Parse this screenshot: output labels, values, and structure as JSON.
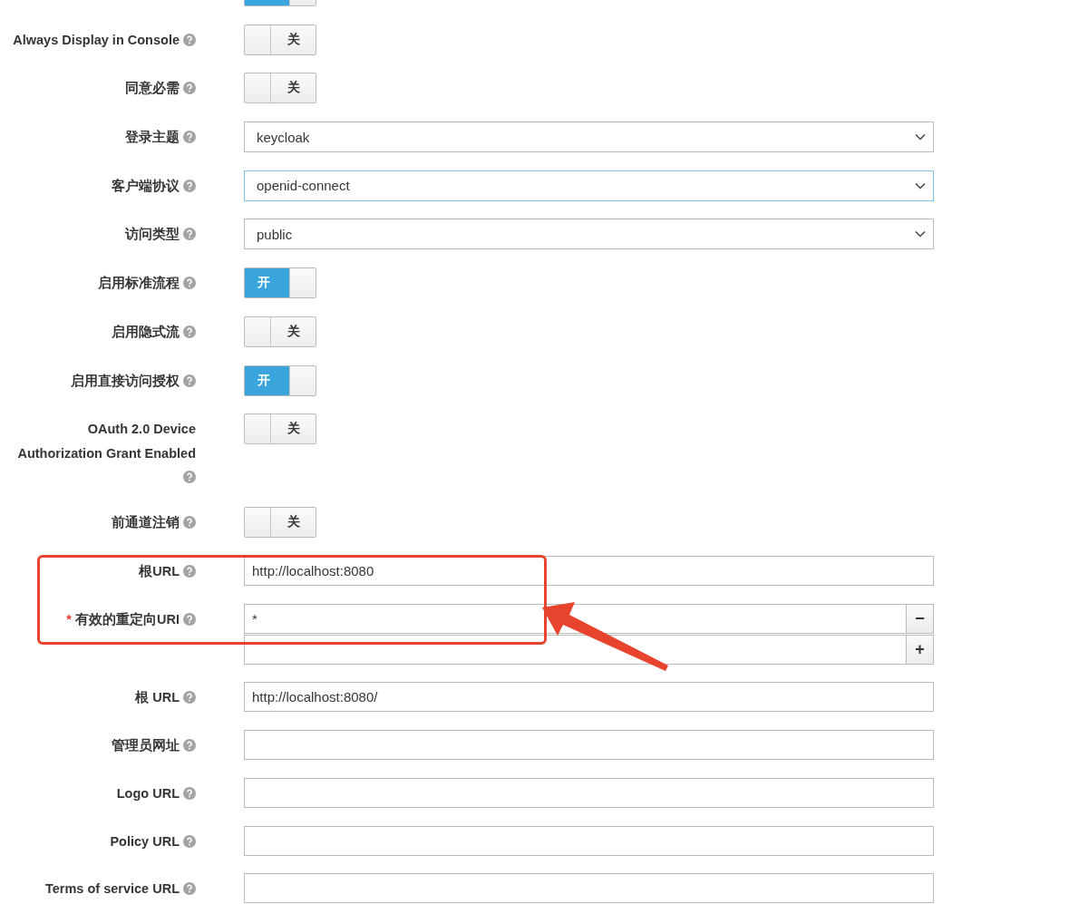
{
  "form": {
    "rows": [
      {
        "kind": "toggle",
        "on": true
      },
      {
        "kind": "toggle",
        "label": "Always Display in Console",
        "on": false,
        "text": "关"
      },
      {
        "kind": "toggle",
        "label": "同意必需",
        "on": false,
        "text": "关"
      },
      {
        "kind": "select",
        "label": "登录主题",
        "value": "keycloak",
        "focused": false
      },
      {
        "kind": "select",
        "label": "客户端协议",
        "value": "openid-connect",
        "focused": true
      },
      {
        "kind": "select",
        "label": "访问类型",
        "value": "public",
        "focused": false
      },
      {
        "kind": "toggle",
        "label": "启用标准流程",
        "on": true,
        "text": "开"
      },
      {
        "kind": "toggle",
        "label": "启用隐式流",
        "on": false,
        "text": "关"
      },
      {
        "kind": "toggle",
        "label": "启用直接访问授权",
        "on": true,
        "text": "开"
      },
      {
        "kind": "toggle",
        "label": "OAuth 2.0 Device Authorization Grant Enabled",
        "on": false,
        "text": "关"
      },
      {
        "kind": "toggle",
        "label": "前通道注销",
        "on": false,
        "text": "关"
      },
      {
        "kind": "input",
        "label": "根URL",
        "value": "http://localhost:8080"
      },
      {
        "kind": "multi",
        "label": "有效的重定向URI",
        "marker": "*",
        "inputs": [
          {
            "value": "*",
            "button": "−"
          },
          {
            "button": "+"
          }
        ]
      },
      {
        "kind": "input",
        "label": "根 URL",
        "value": "http://localhost:8080/"
      },
      {
        "kind": "input",
        "label": "管理员网址"
      },
      {
        "kind": "input",
        "label": "Logo URL"
      },
      {
        "kind": "input",
        "label": "Policy URL"
      },
      {
        "kind": "input",
        "label": "Terms of service URL"
      }
    ]
  }
}
